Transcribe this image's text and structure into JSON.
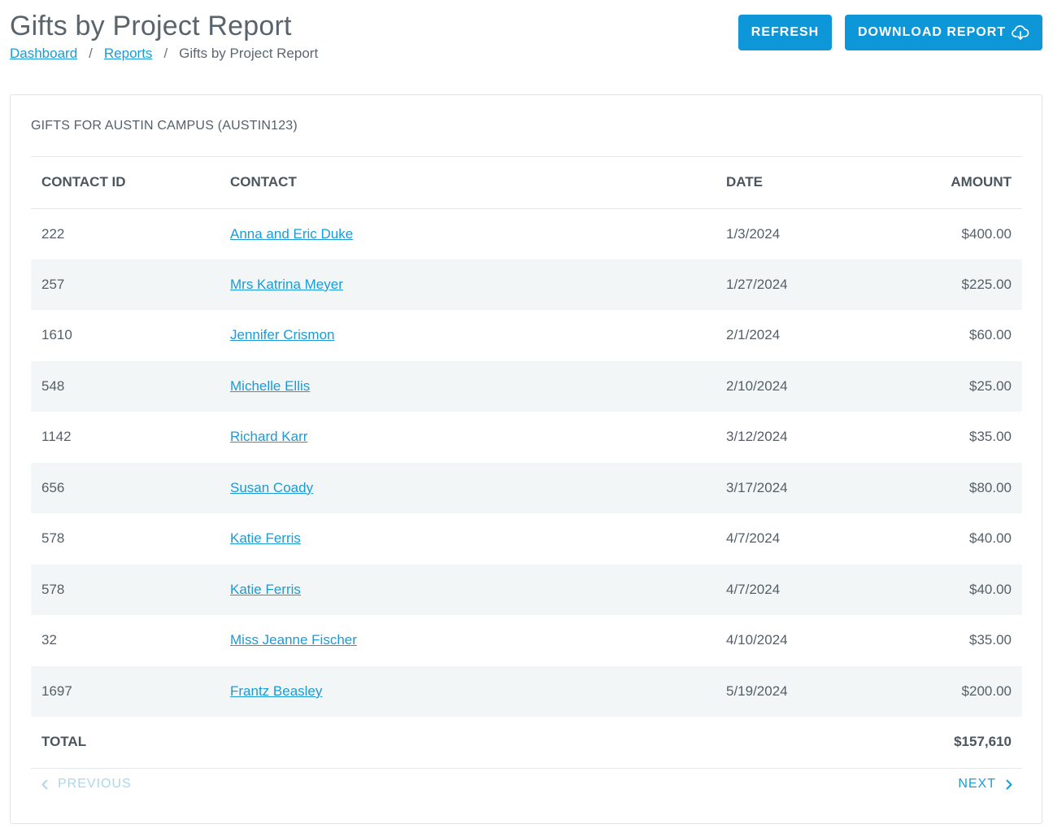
{
  "header": {
    "title": "Gifts by Project Report",
    "breadcrumb": [
      "Dashboard",
      "Reports",
      "Gifts by Project Report"
    ],
    "refresh_label": "REFRESH",
    "download_label": "DOWNLOAD REPORT"
  },
  "colors": {
    "accent": "#0d96d8",
    "link": "#1a9bd7",
    "row_stripe": "#f3f6f6"
  },
  "report": {
    "title": "GIFTS FOR AUSTIN CAMPUS (AUSTIN123)",
    "columns": [
      "CONTACT ID",
      "CONTACT",
      "DATE",
      "AMOUNT"
    ],
    "rows": [
      {
        "id": "222",
        "contact": "Anna and Eric Duke",
        "date": "1/3/2024",
        "amount": "$400.00"
      },
      {
        "id": "257",
        "contact": "Mrs Katrina Meyer",
        "date": "1/27/2024",
        "amount": "$225.00"
      },
      {
        "id": "1610",
        "contact": "Jennifer Crismon",
        "date": "2/1/2024",
        "amount": "$60.00"
      },
      {
        "id": "548",
        "contact": "Michelle Ellis",
        "date": "2/10/2024",
        "amount": "$25.00"
      },
      {
        "id": "1142",
        "contact": "Richard Karr",
        "date": "3/12/2024",
        "amount": "$35.00"
      },
      {
        "id": "656",
        "contact": "Susan Coady",
        "date": "3/17/2024",
        "amount": "$80.00"
      },
      {
        "id": "578",
        "contact": "Katie Ferris",
        "date": "4/7/2024",
        "amount": "$40.00"
      },
      {
        "id": "578",
        "contact": "Katie Ferris",
        "date": "4/7/2024",
        "amount": "$40.00"
      },
      {
        "id": "32",
        "contact": "Miss Jeanne Fischer",
        "date": "4/10/2024",
        "amount": "$35.00"
      },
      {
        "id": "1697",
        "contact": "Frantz Beasley",
        "date": "5/19/2024",
        "amount": "$200.00"
      }
    ],
    "total_label": "TOTAL",
    "total_value": "$157,610"
  },
  "pager": {
    "prev_label": "PREVIOUS",
    "next_label": "NEXT",
    "prev_icon": "chevron-left-icon",
    "next_icon": "chevron-right-icon"
  }
}
